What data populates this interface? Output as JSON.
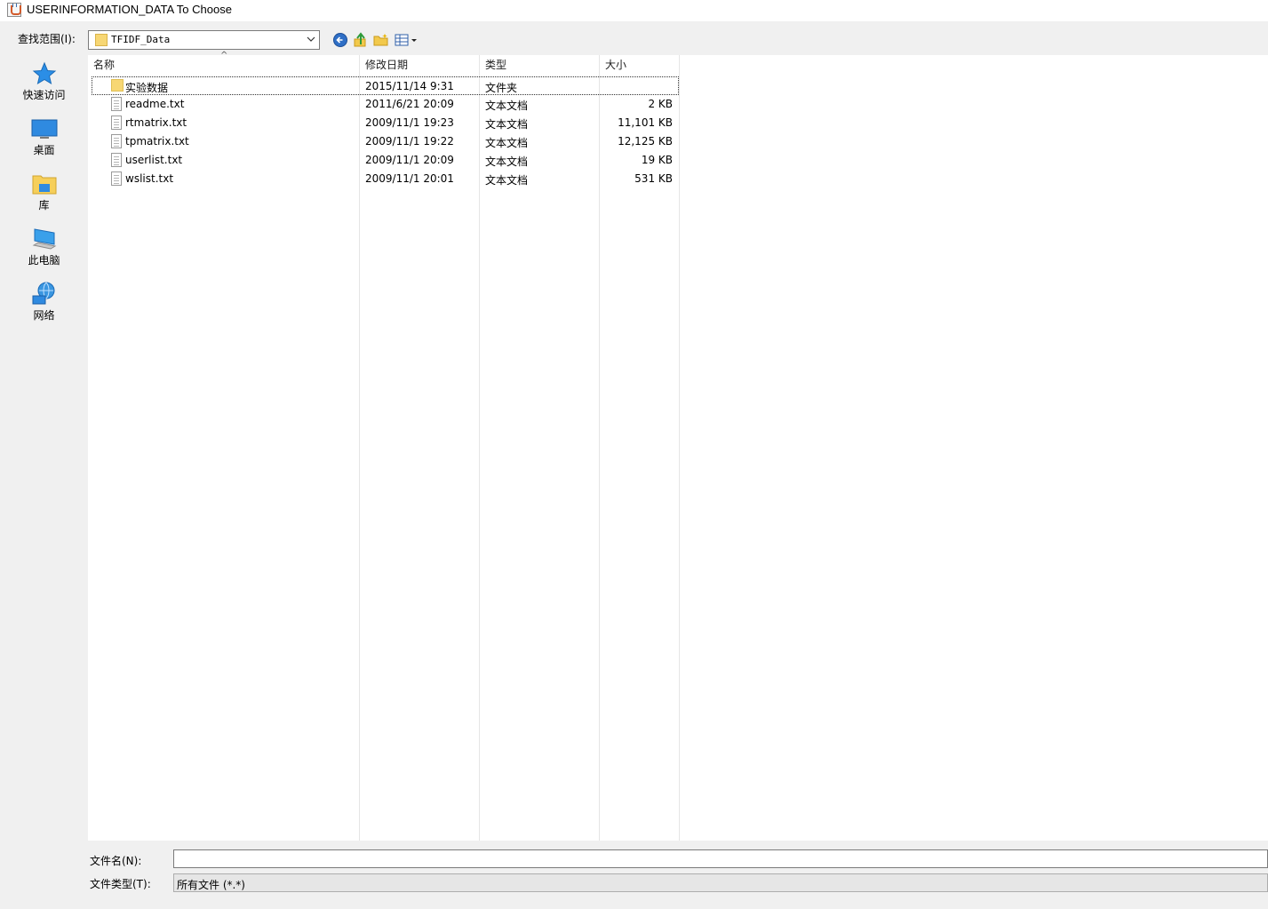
{
  "window": {
    "title": "USERINFORMATION_DATA To Choose"
  },
  "toolbar": {
    "look_in_label": "查找范围(I):",
    "look_in_value": "TFIDF_Data"
  },
  "places": [
    {
      "label": "快速访问",
      "icon": "star-icon"
    },
    {
      "label": "桌面",
      "icon": "desktop-icon"
    },
    {
      "label": "库",
      "icon": "library-icon"
    },
    {
      "label": "此电脑",
      "icon": "computer-icon"
    },
    {
      "label": "网络",
      "icon": "network-icon"
    }
  ],
  "file_list": {
    "columns": [
      "名称",
      "修改日期",
      "类型",
      "大小"
    ],
    "sort_indicator": "^",
    "rows": [
      {
        "name": "实验数据",
        "modified": "2015/11/14 9:31",
        "type": "文件夹",
        "size": "",
        "kind": "folder"
      },
      {
        "name": "readme.txt",
        "modified": "2011/6/21 20:09",
        "type": "文本文档",
        "size": "2 KB",
        "kind": "file"
      },
      {
        "name": "rtmatrix.txt",
        "modified": "2009/11/1 19:23",
        "type": "文本文档",
        "size": "11,101 KB",
        "kind": "file"
      },
      {
        "name": "tpmatrix.txt",
        "modified": "2009/11/1 19:22",
        "type": "文本文档",
        "size": "12,125 KB",
        "kind": "file"
      },
      {
        "name": "userlist.txt",
        "modified": "2009/11/1 20:09",
        "type": "文本文档",
        "size": "19 KB",
        "kind": "file"
      },
      {
        "name": "wslist.txt",
        "modified": "2009/11/1 20:01",
        "type": "文本文档",
        "size": "531 KB",
        "kind": "file"
      }
    ]
  },
  "bottom": {
    "file_name_label": "文件名(N):",
    "file_name_value": "",
    "file_type_label": "文件类型(T):",
    "file_type_value": "所有文件 (*.*)"
  }
}
